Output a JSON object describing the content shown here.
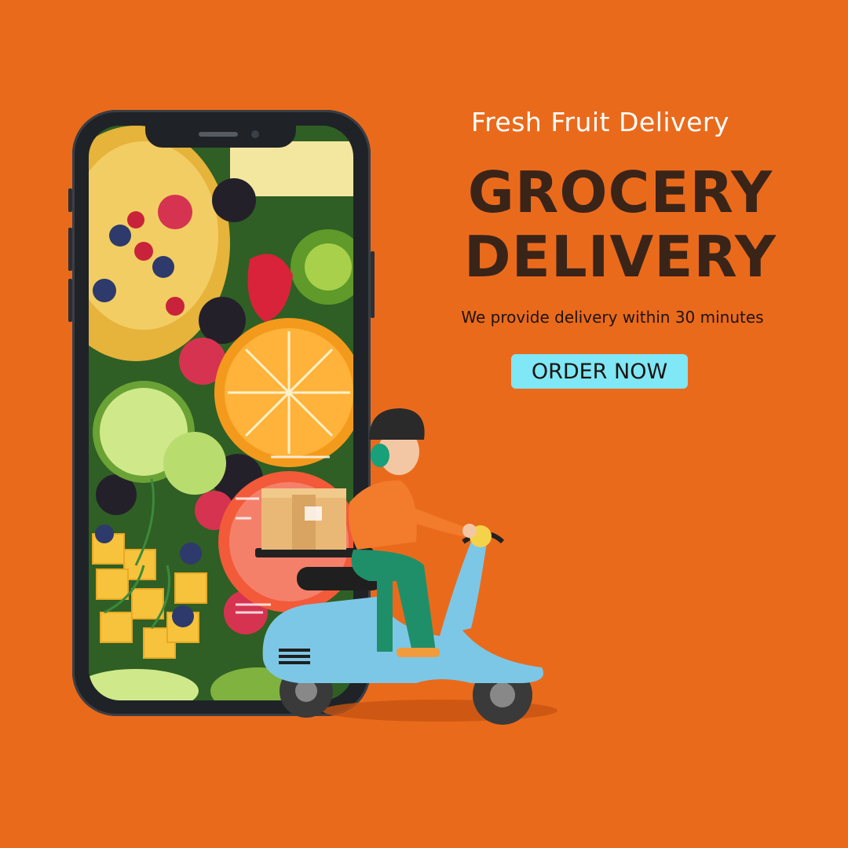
{
  "promo": {
    "subtitle": "Fresh Fruit Delivery",
    "headline_line1": "GROCERY",
    "headline_line2": "DELIVERY",
    "tagline": "We provide delivery within 30 minutes",
    "cta_label": "ORDER NOW"
  },
  "colors": {
    "background": "#ea6a1c",
    "headline": "#3a2418",
    "cta_background": "#7fe7f5"
  },
  "icons": [
    "smartphone-icon",
    "delivery-scooter-illustration",
    "parcel-box-icon"
  ]
}
